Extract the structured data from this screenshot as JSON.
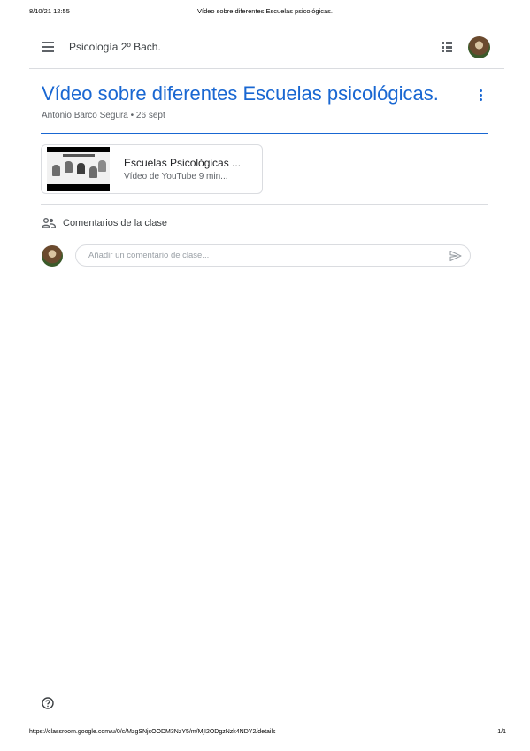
{
  "print": {
    "timestamp": "8/10/21 12:55",
    "page_title": "Vídeo sobre diferentes Escuelas psicológicas.",
    "url": "https://classroom.google.com/u/0/c/MzgSNjcOODM3NzY5/m/MjI2ODgzNzk4NDY2/details",
    "page_number": "1/1"
  },
  "header": {
    "class_name": "Psicología 2º Bach.",
    "icons": [
      "menu-icon",
      "apps-icon",
      "avatar"
    ]
  },
  "post": {
    "title": "Vídeo sobre diferentes Escuelas psicológicas.",
    "author": "Antonio Barco Segura",
    "separator": "•",
    "date": "26 sept",
    "accent_color": "#1967d2"
  },
  "attachment": {
    "title": "Escuelas Psicológicas ...",
    "subtitle": "Vídeo de YouTube  9 min..."
  },
  "comments": {
    "label": "Comentarios de la clase",
    "placeholder": "Añadir un comentario de clase..."
  }
}
